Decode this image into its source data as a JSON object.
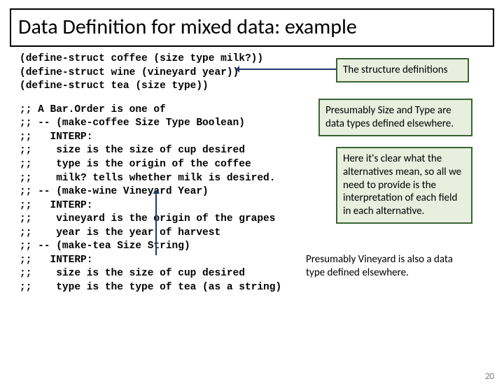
{
  "title": "Data Definition for mixed data: example",
  "code": {
    "defs": "(define-struct coffee (size type milk?))\n(define-struct wine (vineyard year))\n(define-struct tea (size type))",
    "comments": ";; A Bar.Order is one of\n;; -- (make-coffee Size Type Boolean)\n;;   INTERP:\n;;    size is the size of cup desired\n;;    type is the origin of the coffee\n;;    milk? tells whether milk is desired.\n;; -- (make-wine Vineyard Year)\n;;   INTERP:\n;;    vineyard is the origin of the grapes\n;;    year is the year of harvest\n;; -- (make-tea Size String)\n;;   INTERP:\n;;    size is the size of cup desired\n;;    type is the type of tea (as a string)"
  },
  "callouts": {
    "c1": "The structure definitions",
    "c2": "Presumably Size and Type are data types defined elsewhere.",
    "c3": "Here it's clear what the alternatives mean, so all we need to provide is the interpretation of each field in each alternative.",
    "c4": "Presumably Vineyard is also a data type defined elsewhere."
  },
  "slide_number": "20"
}
